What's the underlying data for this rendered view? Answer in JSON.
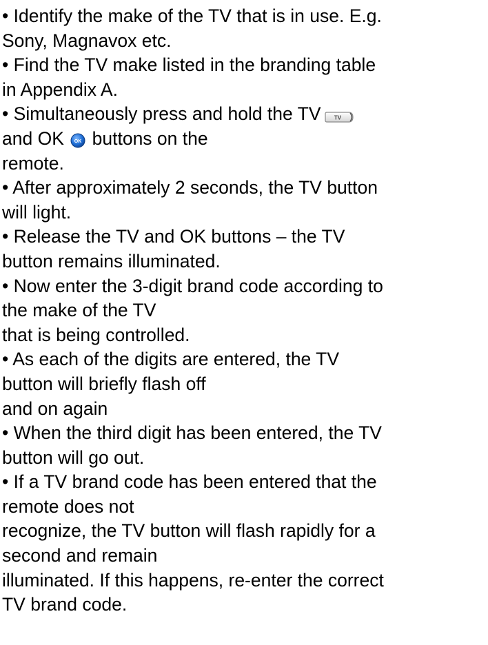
{
  "bullet": "•",
  "icons": {
    "tv_button": {
      "name": "tv-button-icon",
      "label": "TV"
    },
    "ok_button": {
      "name": "ok-button-icon",
      "label": "OK",
      "color": "#1f6fd6"
    }
  },
  "lines": {
    "l1": "Identify the make of the TV that is in use. E.g.",
    "l2": "Sony, Magnavox etc.",
    "l3": "Find the TV make listed in the branding table",
    "l4": "in Appendix A.",
    "l5a": "Simultaneously press and hold the TV",
    "l6a": "and OK",
    "l6b": "buttons on the",
    "l7": "remote.",
    "l8": "After approximately 2 seconds, the TV button",
    "l9": "will light.",
    "l10": "Release the TV and OK buttons – the TV",
    "l11": "button remains illuminated.",
    "l12": "Now enter the 3-digit brand code according to",
    "l13": "the make of the TV",
    "l14": "that is being controlled.",
    "l15": "As each of the digits are entered, the TV",
    "l16": "button will briefly flash off",
    "l17": "and on again",
    "l18": "When the third digit has been entered, the TV",
    "l19": "button will go out.",
    "l20": "If a TV brand code has been entered that the",
    "l21": "remote does not",
    "l22": "recognize, the TV button will flash rapidly for a",
    "l23": "second and remain",
    "l24": "illuminated. If this happens, re-enter the correct",
    "l25": "TV brand code."
  }
}
